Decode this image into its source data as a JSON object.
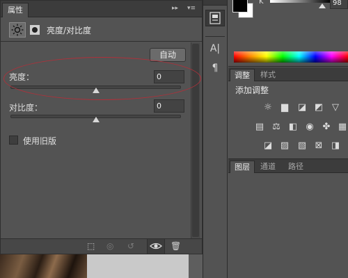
{
  "properties_panel": {
    "tab_label": "属性",
    "header_controls": {
      "collapse": "▸▸",
      "menu": "▾≡"
    },
    "title": "亮度/对比度",
    "auto_button": "自动",
    "brightness": {
      "label": "亮度：",
      "value": "0",
      "slider_fraction": 0.5
    },
    "contrast": {
      "label": "对比度：",
      "value": "0",
      "slider_fraction": 0.5
    },
    "legacy": {
      "label": "使用旧版",
      "checked": false
    },
    "annotation_color": "#b0303a"
  },
  "color_panel": {
    "foreground": "#000000",
    "background": "#ffffff",
    "channel_label": "K",
    "channel_value": "98"
  },
  "tool_strip": {
    "items": [
      {
        "name": "adjustments-panel-icon",
        "glyph": "▣"
      },
      {
        "name": "character-panel-icon",
        "glyph": "A|"
      },
      {
        "name": "paragraph-panel-icon",
        "glyph": "¶"
      }
    ]
  },
  "adjustments_panel": {
    "tabs": [
      "调整",
      "样式"
    ],
    "heading": "添加调整",
    "icons": [
      [
        "brightness-contrast-icon",
        "levels-icon",
        "curves-icon",
        "exposure-icon",
        "vibrance-icon"
      ],
      [
        "hue-saturation-icon",
        "color-balance-icon",
        "black-white-icon",
        "photo-filter-icon",
        "channel-mixer-icon",
        "color-lookup-icon"
      ],
      [
        "invert-icon",
        "posterize-icon",
        "threshold-icon",
        "gradient-map-icon",
        "selective-color-icon"
      ]
    ]
  },
  "layers_panel": {
    "tabs": [
      "图层",
      "通道",
      "路径"
    ]
  }
}
